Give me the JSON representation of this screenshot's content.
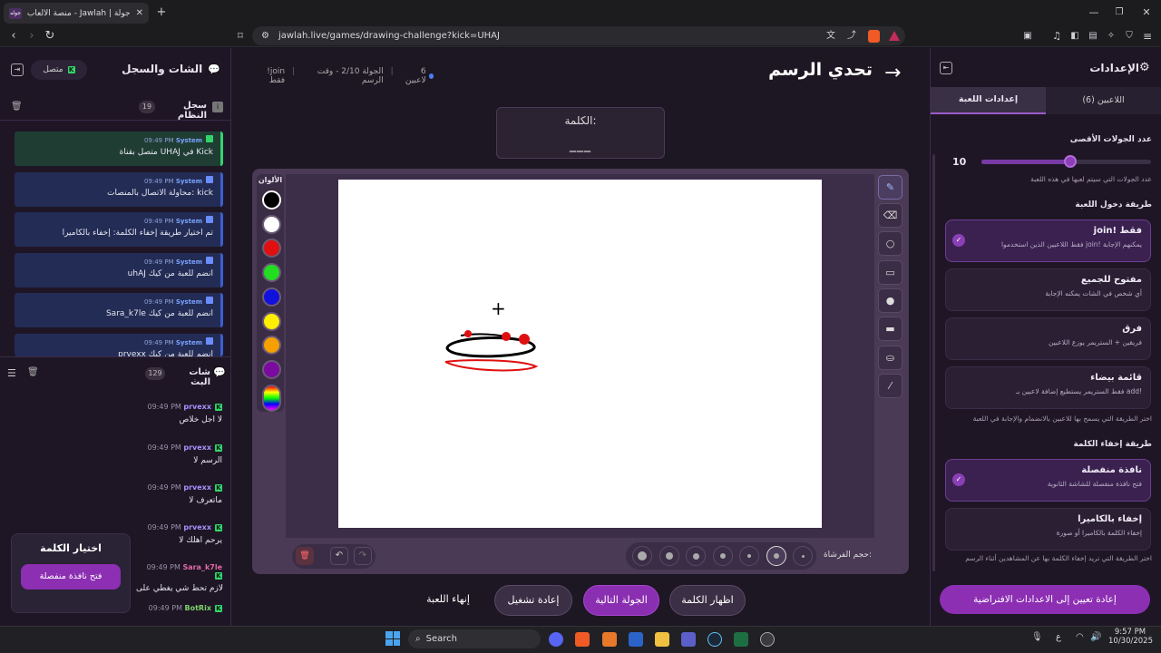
{
  "browser": {
    "tab_title": "جولة | Jawlah - منصة الألعاب التفا",
    "favicon_text": "جوله",
    "url": "jawlah.live/games/drawing-challenge?kick=UHAJ"
  },
  "left": {
    "title": "الشات والسجل",
    "status": "متصل",
    "syslog_title": "سجل النظام",
    "syslog_count": "19",
    "sys_messages": [
      {
        "user": "System",
        "time": "09:49 PM",
        "text": "متصل بقناة UHAJ في Kick"
      },
      {
        "user": "System",
        "time": "09:49 PM",
        "text": "محاولة الاتصال بالمنصات: kick"
      },
      {
        "user": "System",
        "time": "09:49 PM",
        "text": "تم اختيار طريقة إخفاء الكلمة: إخفاء بالكاميرا"
      },
      {
        "user": "System",
        "time": "09:49 PM",
        "text": "uhAJ انضم للعبة من كيك"
      },
      {
        "user": "System",
        "time": "09:49 PM",
        "text": "Sara_k7le انضم للعبة من كيك"
      },
      {
        "user": "System",
        "time": "09:49 PM",
        "text": "prvexx انضم للعبة من كيك"
      }
    ],
    "chat_title": "شات البث",
    "chat_count": "129",
    "chat_messages": [
      {
        "user": "prvexx",
        "time": "09:49 PM",
        "text": "لا اجل خلاص"
      },
      {
        "user": "prvexx",
        "time": "09:49 PM",
        "text": "الرسم لا"
      },
      {
        "user": "prvexx",
        "time": "09:49 PM",
        "text": "ماتعرف لا"
      },
      {
        "user": "prvexx",
        "time": "09:49 PM",
        "text": "يرحم اهلك لا"
      },
      {
        "user": "Sara_k7le",
        "time": "09:49 PM",
        "text": "لازم تحط شي يغطي على"
      },
      {
        "user": "BotRix",
        "time": "09:49 PM",
        "text": ""
      }
    ],
    "popup": {
      "title_a": "اختيار ",
      "title_b": "الكلمة",
      "button": "فتح نافذة منفصلة"
    }
  },
  "center": {
    "title": "تحدي الرسم",
    "players": "6 لاعبين",
    "round": "الجولة 2/10 - وقت الرسم",
    "mode": "join! فقط",
    "word_label": "الكلمة:",
    "word_value": "___",
    "colors_label": "الألوان",
    "colors": [
      "#000000",
      "#ffffff",
      "#e01010",
      "#22dd22",
      "#1111dd",
      "#ffee00",
      "#f5a000",
      "#7a0aa0"
    ],
    "brush_label": "حجم الفرشاة:",
    "buttons": {
      "show_word": "اظهار الكلمة",
      "next_round": "الجولة التالية",
      "restart": "إعادة تشغيل",
      "end_game": "إنهاء اللعبة"
    }
  },
  "right": {
    "title": "الإعدادات",
    "tab_players": "اللاعبين (6)",
    "tab_settings": "إعدادات اللعبة",
    "max_rounds_label": "عدد الجولات الأقصى",
    "max_rounds_value": "10",
    "max_rounds_hint": "عدد الجولات التي سيتم لعبها في هذه اللعبة",
    "join_method_label": "طريقة دخول اللعبة",
    "join_options": [
      {
        "title": "join! فقط",
        "desc": "فقط اللاعبين الذين استخدموا join! يمكنهم الإجابة",
        "selected": true
      },
      {
        "title": "مفتوح للجميع",
        "desc": "أي شخص في الشات يمكنه الإجابة",
        "selected": false
      },
      {
        "title": "فرق",
        "desc": "فريقين + الستريمر يوزع اللاعبين",
        "selected": false
      },
      {
        "title": "قائمة بيضاء",
        "desc": "فقط الستريمر يستطيع إضافة لاعبين بـ add!",
        "selected": false
      }
    ],
    "join_hint": "اختر الطريقة التي يسمح بها للاعبين بالانضمام والإجابة في اللعبة",
    "hide_method_label": "طريقة إخفاء الكلمة",
    "hide_options": [
      {
        "title": "نافذة منفصلة",
        "desc": "فتح نافذة منفصلة للشاشة الثانوية",
        "selected": true
      },
      {
        "title": "إخفاء بالكاميرا",
        "desc": "إخفاء الكلمة بالكاميرا أو صورة",
        "selected": false
      }
    ],
    "hide_hint": "اختر الطريقة التي تريد إخفاء الكلمة بها عن المشاهدين أثناء الرسم",
    "reset_button": "إعادة تعيين إلى الاعدادات الافتراضية"
  },
  "taskbar": {
    "search": "Search",
    "lang": "ع",
    "time": "9:57 PM",
    "date": "10/30/2025"
  }
}
